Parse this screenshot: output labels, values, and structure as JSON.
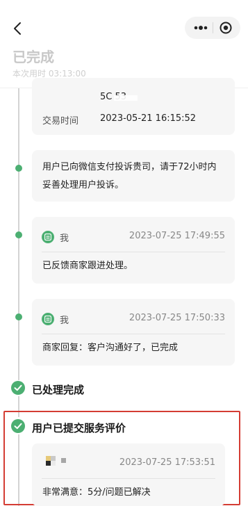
{
  "header": {
    "title": "已完成",
    "elapsed": "本次用时 03:13:00"
  },
  "icons": {
    "back": "chevron-left-icon",
    "more": "more-dots-icon",
    "close": "target-circle-icon",
    "avatar": "message-icon",
    "check": "check-circle-icon"
  },
  "colors": {
    "accent": "#4caf72",
    "highlight_border": "#d43c33"
  },
  "card_order": {
    "partial_value": "5C   53",
    "time_label": "交易时间",
    "time_value": "2023-05-21 16:15:52"
  },
  "card_complaint": {
    "text": "用户已向微信支付投诉贵司，请于72小时内妥善处理用户投诉。"
  },
  "card_me": {
    "who": "我",
    "time": "2023-07-25 17:49:55",
    "text": "已反馈商家跟进处理。"
  },
  "card_merchant": {
    "who": "我",
    "time": "2023-07-25 17:50:33",
    "text": "商家回复：客户沟通好了，已完成"
  },
  "status_done": "已处理完成",
  "status_review": "用户已提交服务评价",
  "card_review": {
    "time": "2023-07-25 17:53:51",
    "text": "非常满意：5分/问题已解决"
  }
}
